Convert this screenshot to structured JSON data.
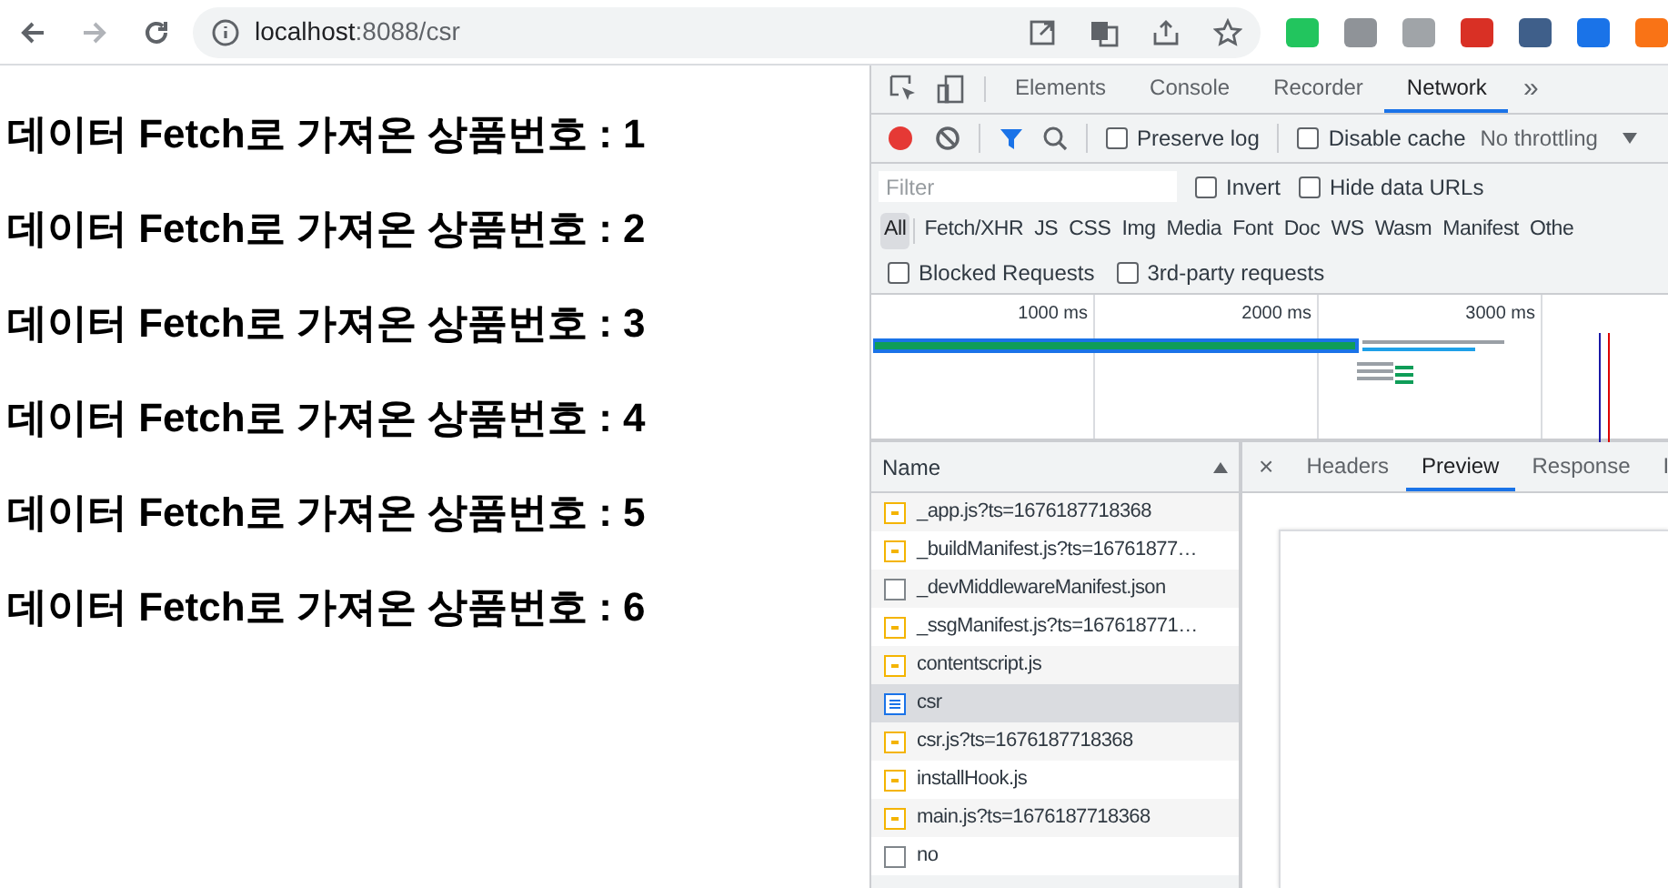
{
  "browser": {
    "url_host": "localhost",
    "url_rest": ":8088/csr",
    "extensions": [
      {
        "color": "#22c55e"
      },
      {
        "color": "#8f9398"
      },
      {
        "color": "#a0a4a8"
      },
      {
        "color": "#d93025"
      },
      {
        "color": "#3f5f8a"
      },
      {
        "color": "#1a73e8"
      },
      {
        "color": "#f97316"
      }
    ]
  },
  "page": {
    "headings": [
      "데이터 Fetch로 가져온 상품번호 : 1",
      "데이터 Fetch로 가져온 상품번호 : 2",
      "데이터 Fetch로 가져온 상품번호 : 3",
      "데이터 Fetch로 가져온 상품번호 : 4",
      "데이터 Fetch로 가져온 상품번호 : 5",
      "데이터 Fetch로 가져온 상품번호 : 6"
    ]
  },
  "devtools": {
    "tabs": [
      {
        "label": "Elements",
        "selected": false
      },
      {
        "label": "Console",
        "selected": false
      },
      {
        "label": "Recorder",
        "selected": false
      },
      {
        "label": "Network",
        "selected": true
      }
    ],
    "more_tabs": "»",
    "toolbar": {
      "preserve_log": {
        "label": "Preserve log",
        "checked": false
      },
      "disable_cache": {
        "label": "Disable cache",
        "checked": false
      },
      "throttling": "No throttling"
    },
    "filter": {
      "placeholder": "Filter",
      "invert": {
        "label": "Invert",
        "checked": false
      },
      "hide_data_urls": {
        "label": "Hide data URLs",
        "checked": false
      }
    },
    "type_filters": [
      {
        "label": "All",
        "selected": true
      },
      {
        "label": "Fetch/XHR",
        "selected": false
      },
      {
        "label": "JS",
        "selected": false
      },
      {
        "label": "CSS",
        "selected": false
      },
      {
        "label": "Img",
        "selected": false
      },
      {
        "label": "Media",
        "selected": false
      },
      {
        "label": "Font",
        "selected": false
      },
      {
        "label": "Doc",
        "selected": false
      },
      {
        "label": "WS",
        "selected": false
      },
      {
        "label": "Wasm",
        "selected": false
      },
      {
        "label": "Manifest",
        "selected": false
      },
      {
        "label": "Othe",
        "selected": false
      }
    ],
    "blocked_requests": {
      "label": "Blocked Requests",
      "checked": false
    },
    "third_party": {
      "label": "3rd-party requests",
      "checked": false
    },
    "timeline_ticks": [
      "1000 ms",
      "2000 ms",
      "3000 ms"
    ],
    "requests_header": "Name",
    "requests": [
      {
        "name": "_app.js?ts=1676187718368",
        "kind": "script",
        "selected": false
      },
      {
        "name": "_buildManifest.js?ts=16761877…",
        "kind": "script",
        "selected": false
      },
      {
        "name": "_devMiddlewareManifest.json",
        "kind": "other",
        "selected": false
      },
      {
        "name": "_ssgManifest.js?ts=167618771…",
        "kind": "script",
        "selected": false
      },
      {
        "name": "contentscript.js",
        "kind": "script",
        "selected": false
      },
      {
        "name": "csr",
        "kind": "document",
        "selected": true
      },
      {
        "name": "csr.js?ts=1676187718368",
        "kind": "script",
        "selected": false
      },
      {
        "name": "installHook.js",
        "kind": "script",
        "selected": false
      },
      {
        "name": "main.js?ts=1676187718368",
        "kind": "script",
        "selected": false
      },
      {
        "name": "no",
        "kind": "other",
        "selected": false
      }
    ],
    "detail_close": "×",
    "detail_tabs": [
      {
        "label": "Headers",
        "selected": false
      },
      {
        "label": "Preview",
        "selected": true
      },
      {
        "label": "Response",
        "selected": false
      },
      {
        "label": "I",
        "selected": false
      }
    ]
  }
}
